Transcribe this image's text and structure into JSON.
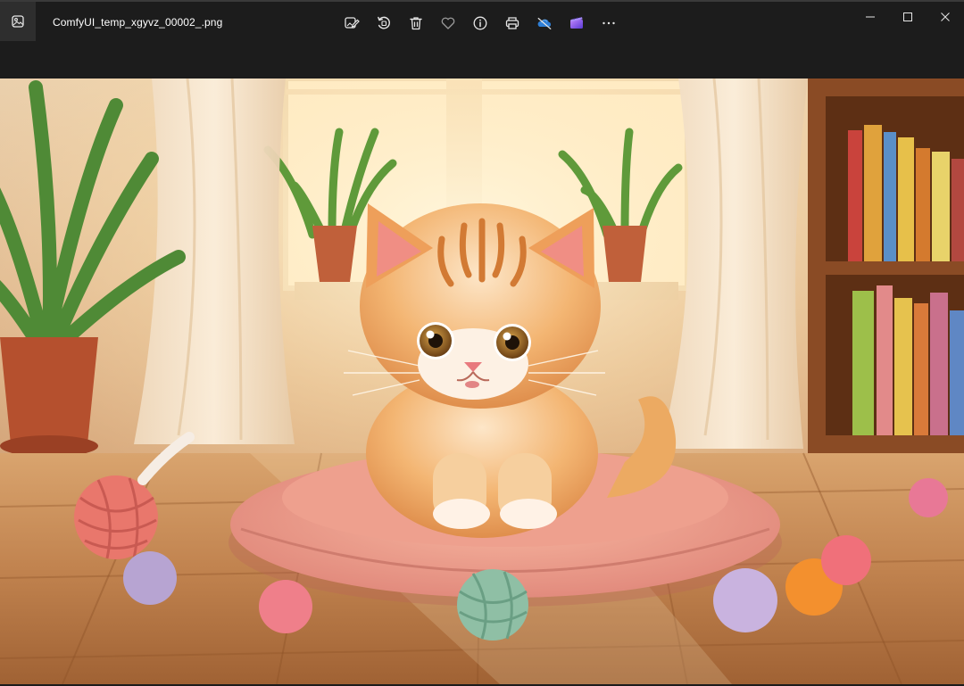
{
  "window": {
    "file_name": "ComfyUI_temp_xgyvz_00002_.png",
    "app_icon": "photos-app-icon"
  },
  "toolbar": {
    "buttons": [
      {
        "name": "edit-image-button",
        "icon": "edit-image-icon",
        "label": "Edit image"
      },
      {
        "name": "rotate-button",
        "icon": "rotate-icon",
        "label": "Rotate"
      },
      {
        "name": "delete-button",
        "icon": "trash-icon",
        "label": "Delete"
      },
      {
        "name": "favorite-button",
        "icon": "heart-icon",
        "label": "Favorite"
      },
      {
        "name": "file-info-button",
        "icon": "info-icon",
        "label": "File information"
      },
      {
        "name": "print-button",
        "icon": "printer-icon",
        "label": "Print"
      },
      {
        "name": "onedrive-button",
        "icon": "onedrive-cloud-off-icon",
        "label": "OneDrive"
      },
      {
        "name": "clipchamp-button",
        "icon": "clipchamp-icon",
        "label": "Clipchamp"
      },
      {
        "name": "more-options-button",
        "icon": "more-horizontal-icon",
        "label": "See more"
      }
    ]
  },
  "window_controls": [
    "minimize",
    "maximize",
    "close"
  ],
  "colors": {
    "titlebar_bg": "#1c1c1c",
    "accent_onedrive": "#3a8ee6",
    "accent_clipchamp": "#8b5cf6"
  },
  "image": {
    "subject": "kitten-on-pink-cushion"
  }
}
